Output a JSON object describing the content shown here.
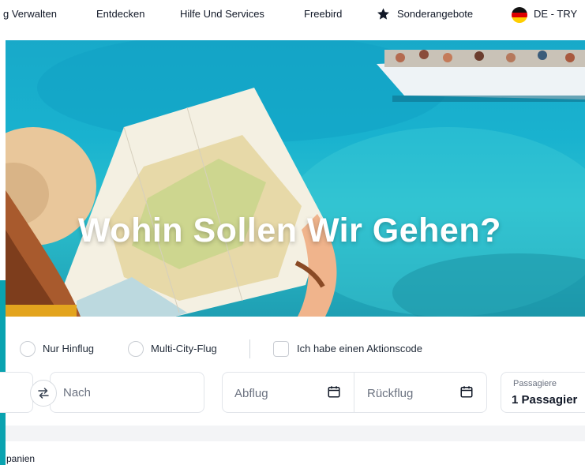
{
  "nav": {
    "items": [
      "g Verwalten",
      "Entdecken",
      "Hilfe Und Services",
      "Freebird",
      "Sonderangebote"
    ],
    "locale": "DE - TRY",
    "icons": [
      "star-icon",
      "germany-flag-icon"
    ]
  },
  "hero": {
    "title": "Wohin Sollen Wir Gehen?"
  },
  "search": {
    "trip_types": [
      "Nur Hinflug",
      "Multi-City-Flug"
    ],
    "promo_label": "Ich habe einen Aktionscode",
    "to_placeholder": "Nach",
    "depart_placeholder": "Abflug",
    "return_placeholder": "Rückflug",
    "passengers_label": "Passagiere",
    "passengers_value": "1 Passagier"
  },
  "footer": {
    "text": "panien"
  },
  "colors": {
    "accent_teal": "#0aa3b0",
    "text": "#111827"
  }
}
